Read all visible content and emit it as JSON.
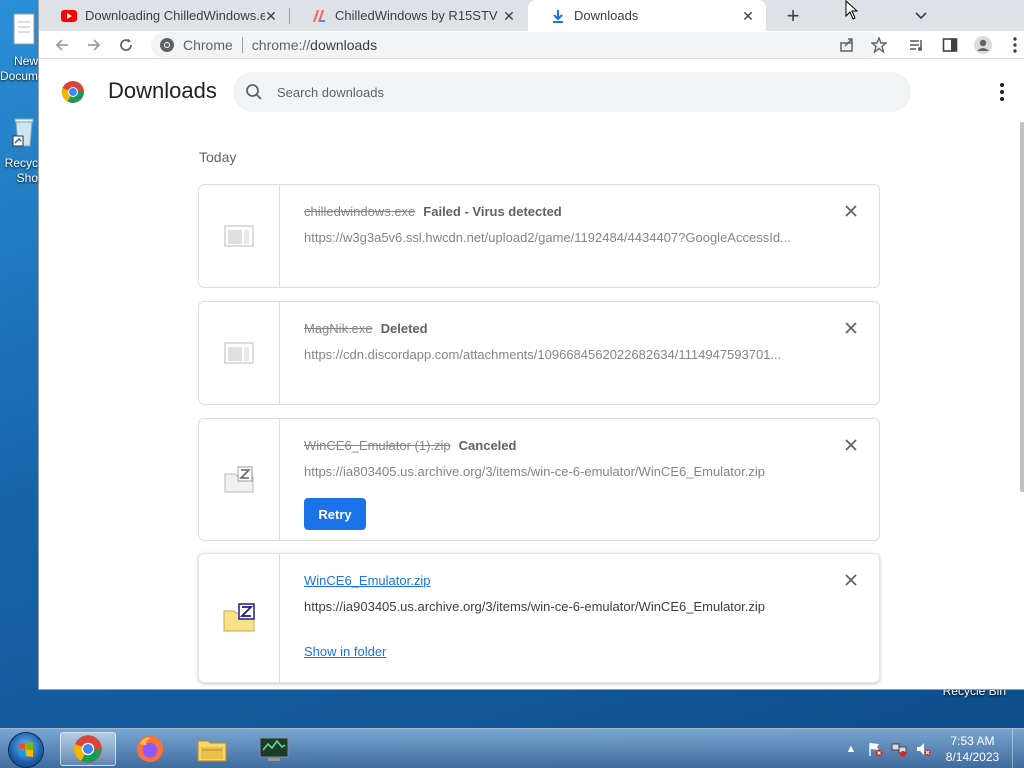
{
  "desktop": {
    "icons": [
      {
        "label_line1": "New",
        "label_line2": "Docum"
      },
      {
        "label_line1": "Recyc",
        "label_line2": "Sho"
      }
    ],
    "recycle_bin_label": "Recycle Bin"
  },
  "browser": {
    "tabs": [
      {
        "title": "Downloading ChilledWindows.exe",
        "icon": "youtube-icon",
        "active": false
      },
      {
        "title": "ChilledWindows by R15STV",
        "icon": "itchio-icon",
        "active": false
      },
      {
        "title": "Downloads",
        "icon": "download-icon",
        "active": true
      }
    ],
    "omnibox": {
      "site_name": "Chrome",
      "url_prefix": "chrome://",
      "url_path": "downloads"
    }
  },
  "downloads": {
    "title": "Downloads",
    "search_placeholder": "Search downloads",
    "date_heading": "Today",
    "items": [
      {
        "filename": "chilledwindows.exe",
        "status": "Failed - Virus detected",
        "url": "https://w3g3a5v6.ssl.hwcdn.net/upload2/game/1192484/4434407?GoogleAccessId...",
        "state": "failed"
      },
      {
        "filename": "MagNik.exe",
        "status": "Deleted",
        "url": "https://cdn.discordapp.com/attachments/1096684562022682634/1114947593701...",
        "state": "deleted"
      },
      {
        "filename": "WinCE6_Emulator (1).zip",
        "status": "Canceled",
        "url": "https://ia803405.us.archive.org/3/items/win-ce-6-emulator/WinCE6_Emulator.zip",
        "state": "canceled",
        "action_label": "Retry"
      },
      {
        "filename": "WinCE6_Emulator.zip",
        "status": "",
        "url": "https://ia903405.us.archive.org/3/items/win-ce-6-emulator/WinCE6_Emulator.zip",
        "state": "complete",
        "action_label": "Show in folder"
      }
    ]
  },
  "taskbar": {
    "apps": [
      "chrome-icon",
      "firefox-icon",
      "file-explorer-icon",
      "monitor-app-icon"
    ],
    "time": "7:53 AM",
    "date": "8/14/2023"
  },
  "colors": {
    "accent": "#1a73e8",
    "text_primary": "#202124",
    "text_secondary": "#5f6368"
  }
}
